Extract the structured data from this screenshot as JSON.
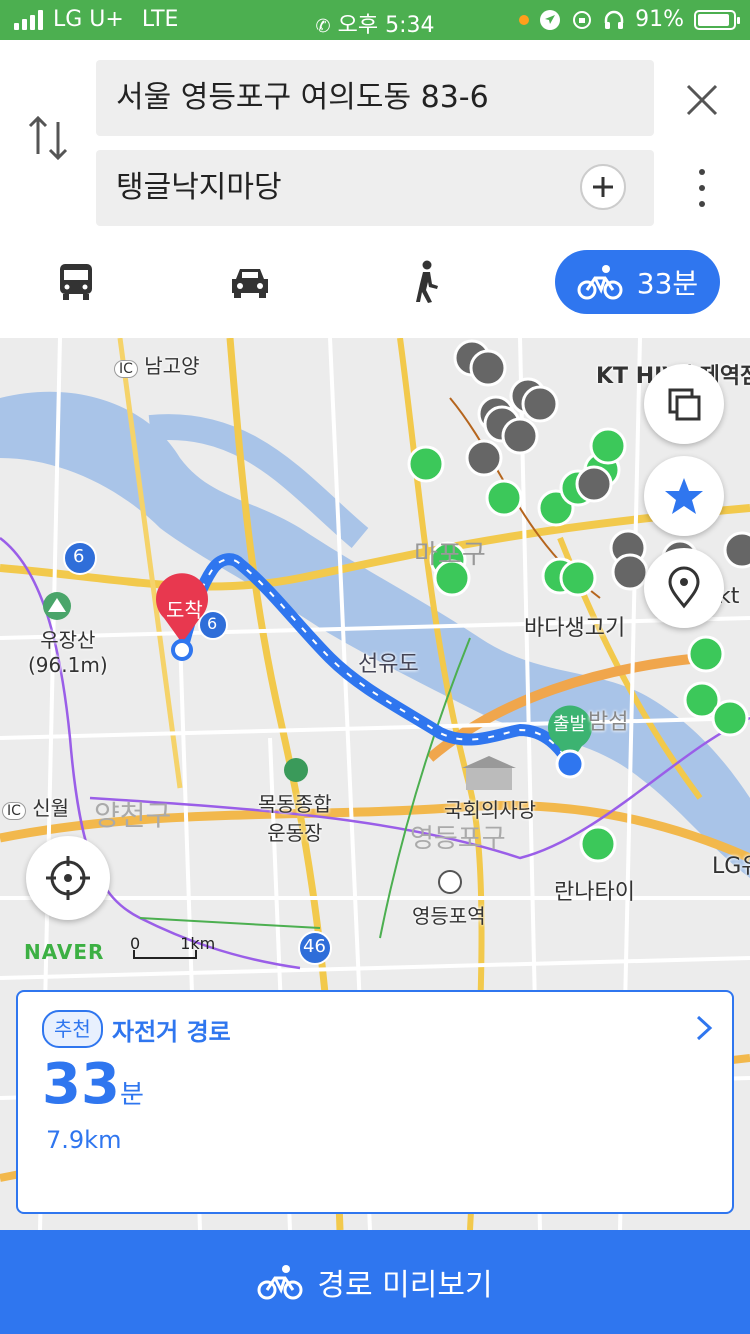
{
  "status_bar": {
    "carrier": "LG U+",
    "network": "LTE",
    "time": "오후 5:34",
    "battery_percent": "91%",
    "battery_level": 0.91
  },
  "search": {
    "origin": "서울 영등포구 여의도동 83-6",
    "destination": "탱글낙지마당",
    "icons": {
      "swap": "swap-arrows-icon",
      "close": "close-icon",
      "add": "plus-icon",
      "more": "more-vertical-icon"
    }
  },
  "modes": {
    "transit_icon": "bus-icon",
    "car_icon": "car-icon",
    "walk_icon": "walking-icon",
    "bike_icon": "bicycle-icon",
    "bike_time": "33분"
  },
  "map": {
    "labels": {
      "namgoyang": "남고양",
      "ic1": "IC",
      "kt": "KT HJV후제역점",
      "mapo": "마포구",
      "seonyudo": "선유도",
      "badasaenggogi": "바다생고기",
      "ujangsan": "우장산",
      "ujangsan_height": "(96.1m)",
      "arrival": "도착",
      "departure": "출발",
      "bamseom": "밤섬",
      "ic2": "IC",
      "sinwol": "신월",
      "yangcheon": "양천구",
      "mokdong": "목동종합",
      "mokdong2": "운동장",
      "national_assembly": "국회의사당",
      "yeongdeungpo_gu": "영등포구",
      "lg": "LG유",
      "rannatai": "란나타이",
      "yeongdeungpo_station": "영등포역",
      "kt2": "kt",
      "route6a": "6",
      "route6b": "6",
      "route46": "46",
      "naver": "NAVER",
      "scale_zero": "0",
      "scale_km": "1km"
    },
    "buttons": {
      "layers": "layers-icon",
      "favorite": "star-icon",
      "location_pin": "location-pin-icon",
      "current_location": "crosshair-icon"
    },
    "colors": {
      "route": "#2f76ef",
      "water": "#a9c4e8",
      "favorite_green": "#3cc85a",
      "arrival_pin": "#e8384f",
      "departure_pin": "#3cb371"
    }
  },
  "route_card": {
    "badge": "추천",
    "title": "자전거 경로",
    "time_value": "33",
    "time_unit": "분",
    "distance": "7.9km"
  },
  "bottom_button": {
    "label": "경로 미리보기",
    "icon": "bicycle-icon"
  },
  "colors": {
    "status_bar": "#4caf50",
    "accent": "#2f76ef"
  }
}
